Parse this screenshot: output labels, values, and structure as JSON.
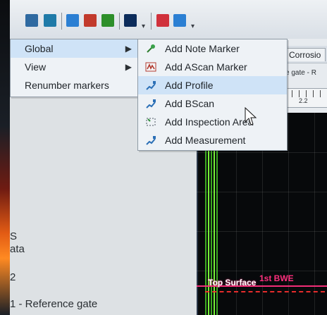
{
  "context_menu": {
    "items": [
      {
        "label": "Global",
        "has_submenu": true
      },
      {
        "label": "View",
        "has_submenu": true
      },
      {
        "label": "Renumber markers",
        "has_submenu": false
      }
    ],
    "submenu": {
      "items": [
        {
          "label": "Add Note Marker",
          "icon": "note-marker-icon"
        },
        {
          "label": "Add AScan Marker",
          "icon": "ascan-marker-icon"
        },
        {
          "label": "Add Profile",
          "icon": "profile-icon",
          "hovered": true
        },
        {
          "label": "Add BScan",
          "icon": "bscan-icon"
        },
        {
          "label": "Add Inspection Area",
          "icon": "inspection-area-icon"
        },
        {
          "label": "Add Measurement",
          "icon": "measurement-icon"
        }
      ]
    }
  },
  "right_panel": {
    "tab_label": "Corrosio",
    "gate_label": "e gate - R",
    "ruler_label": "2.2",
    "overlay": {
      "top_surface": "Top Surface",
      "first_bwe": "1st BWE"
    }
  },
  "left_panel": {
    "lines": [
      {
        "text": "S"
      },
      {
        "text": "ata"
      },
      {
        "text": "2"
      },
      {
        "text": "1 - Reference gate"
      }
    ]
  },
  "colors": {
    "menu_bg": "#eef2f6",
    "hover_bg": "#cfe3f7",
    "scan_green": "#7cff3a",
    "pink": "#ff2f7d",
    "red": "#ff2f2f"
  }
}
